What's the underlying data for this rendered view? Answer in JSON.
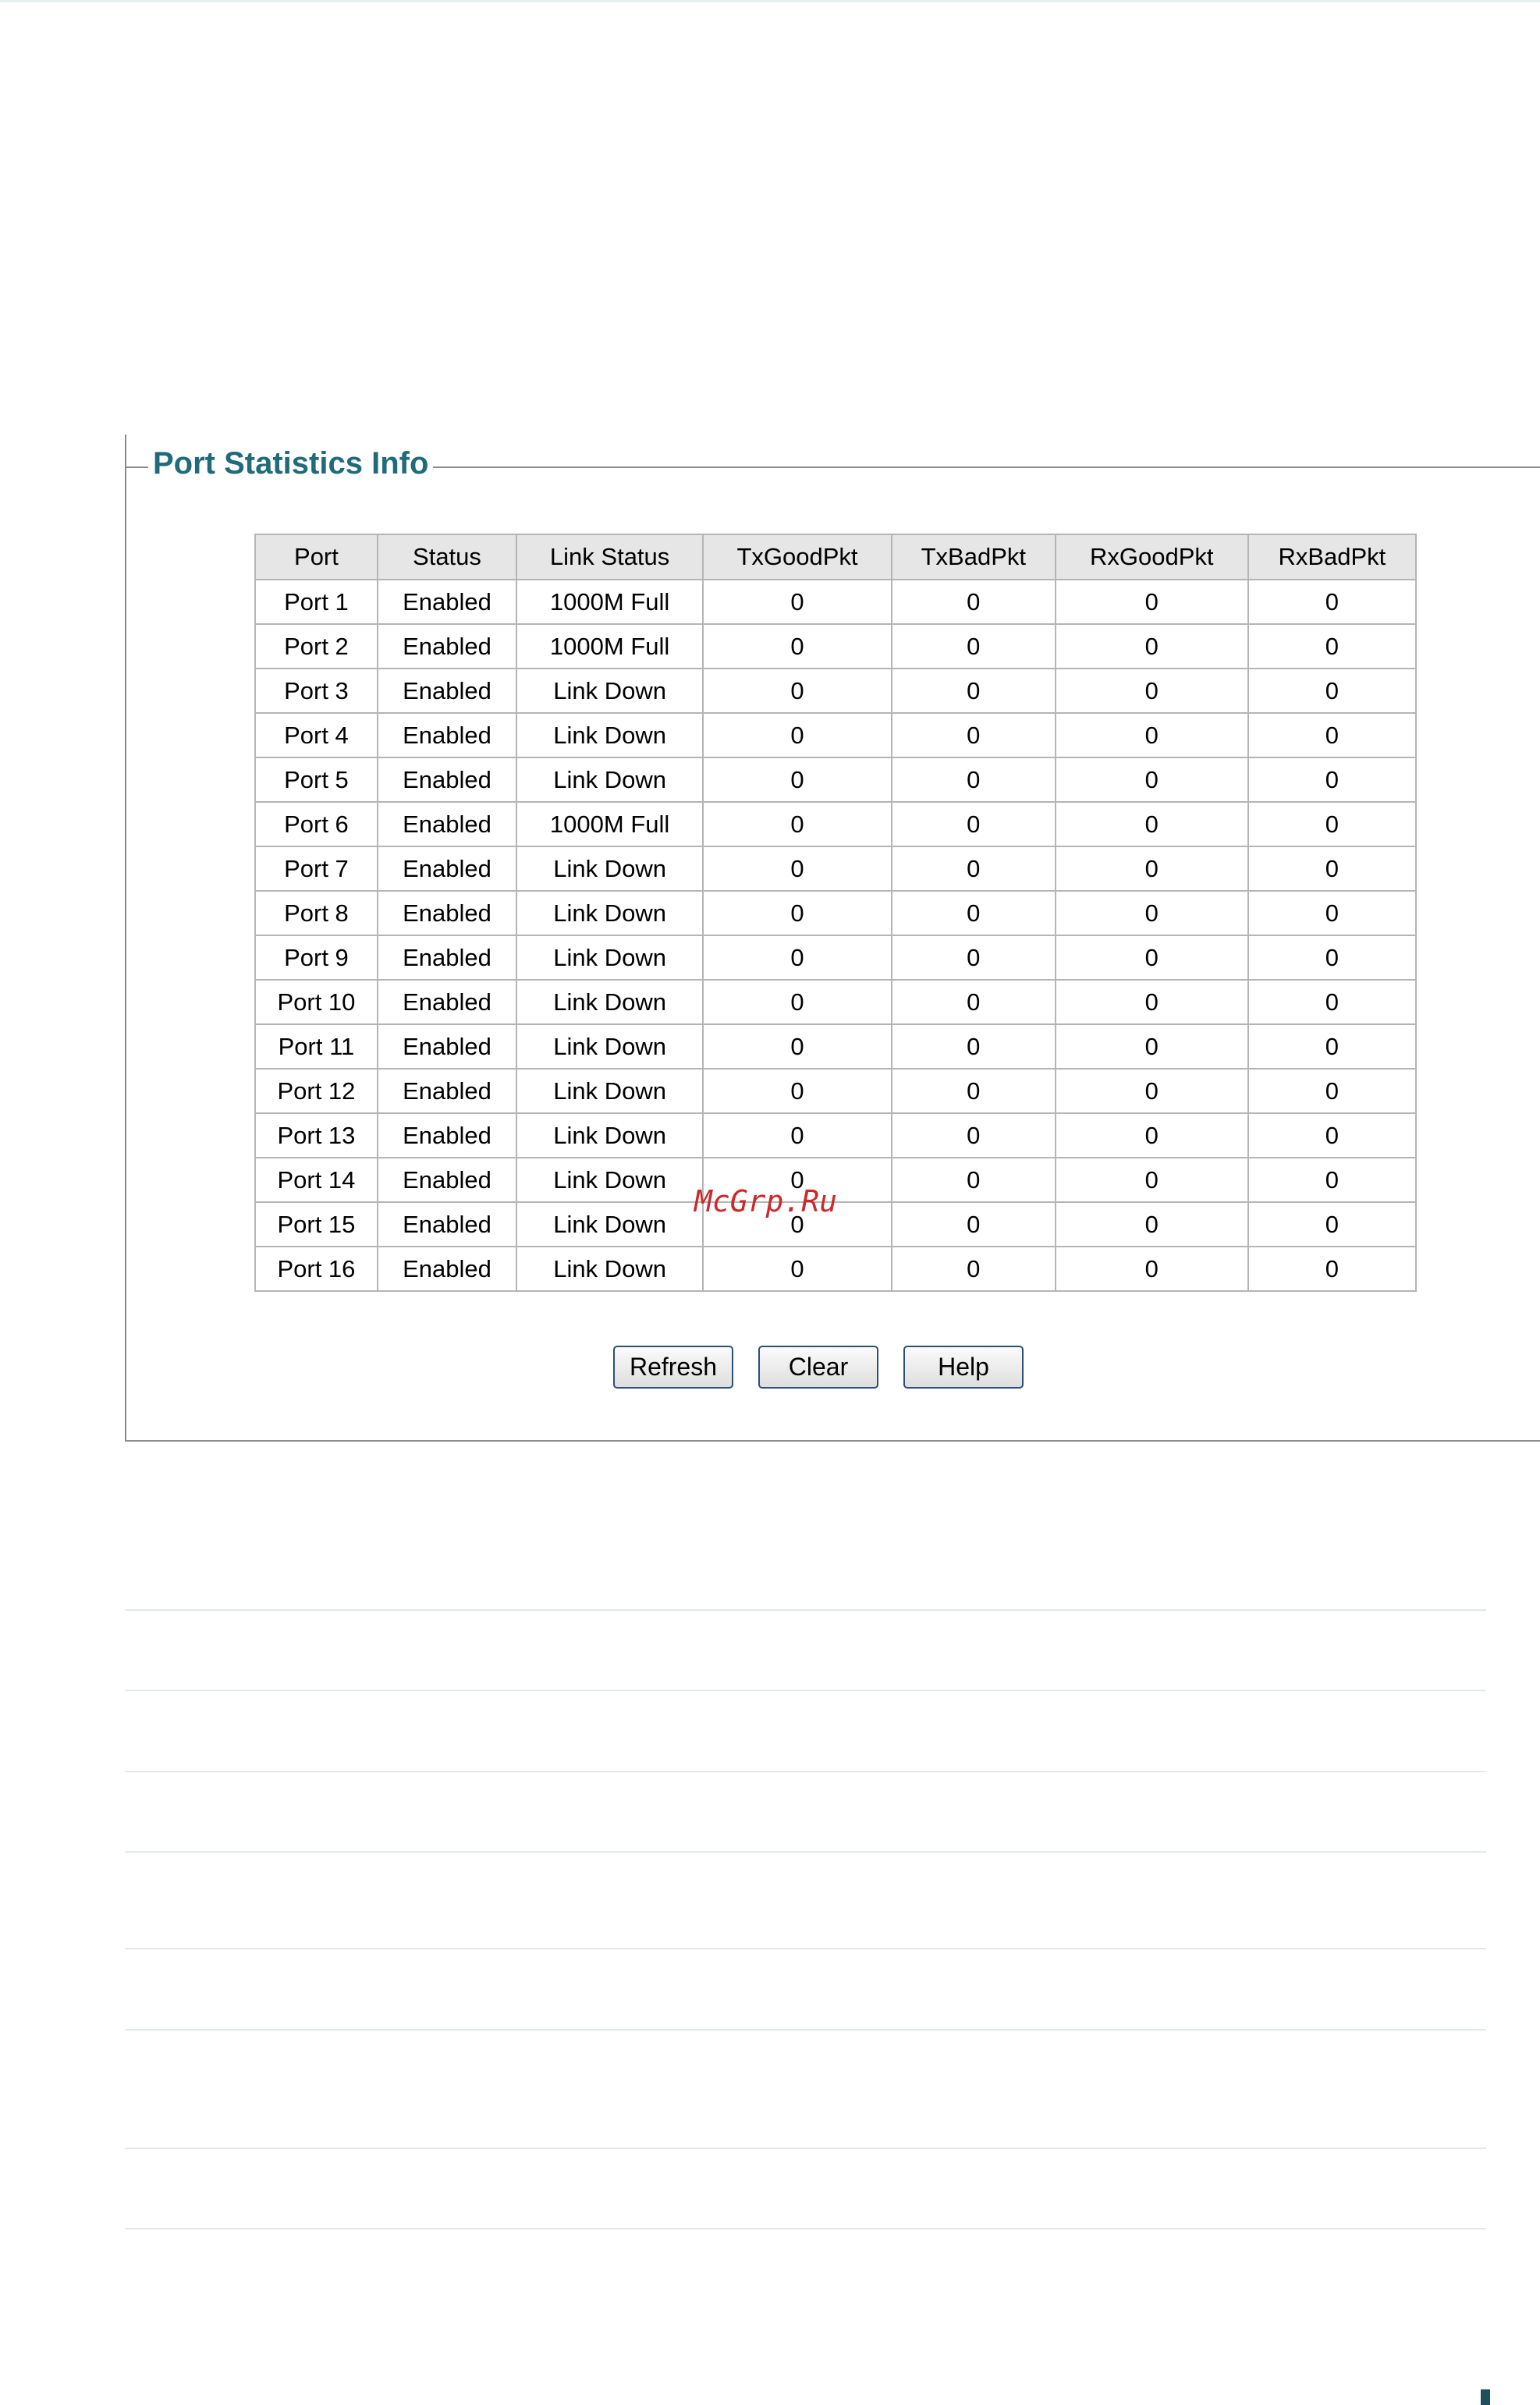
{
  "panel": {
    "title": "Port Statistics Info"
  },
  "table": {
    "headers": [
      "Port",
      "Status",
      "Link Status",
      "TxGoodPkt",
      "TxBadPkt",
      "RxGoodPkt",
      "RxBadPkt"
    ],
    "rows": [
      [
        "Port 1",
        "Enabled",
        "1000M Full",
        "0",
        "0",
        "0",
        "0"
      ],
      [
        "Port 2",
        "Enabled",
        "1000M Full",
        "0",
        "0",
        "0",
        "0"
      ],
      [
        "Port 3",
        "Enabled",
        "Link Down",
        "0",
        "0",
        "0",
        "0"
      ],
      [
        "Port 4",
        "Enabled",
        "Link Down",
        "0",
        "0",
        "0",
        "0"
      ],
      [
        "Port 5",
        "Enabled",
        "Link Down",
        "0",
        "0",
        "0",
        "0"
      ],
      [
        "Port 6",
        "Enabled",
        "1000M Full",
        "0",
        "0",
        "0",
        "0"
      ],
      [
        "Port 7",
        "Enabled",
        "Link Down",
        "0",
        "0",
        "0",
        "0"
      ],
      [
        "Port 8",
        "Enabled",
        "Link Down",
        "0",
        "0",
        "0",
        "0"
      ],
      [
        "Port 9",
        "Enabled",
        "Link Down",
        "0",
        "0",
        "0",
        "0"
      ],
      [
        "Port 10",
        "Enabled",
        "Link Down",
        "0",
        "0",
        "0",
        "0"
      ],
      [
        "Port 11",
        "Enabled",
        "Link Down",
        "0",
        "0",
        "0",
        "0"
      ],
      [
        "Port 12",
        "Enabled",
        "Link Down",
        "0",
        "0",
        "0",
        "0"
      ],
      [
        "Port 13",
        "Enabled",
        "Link Down",
        "0",
        "0",
        "0",
        "0"
      ],
      [
        "Port 14",
        "Enabled",
        "Link Down",
        "0",
        "0",
        "0",
        "0"
      ],
      [
        "Port 15",
        "Enabled",
        "Link Down",
        "0",
        "0",
        "0",
        "0"
      ],
      [
        "Port 16",
        "Enabled",
        "Link Down",
        "0",
        "0",
        "0",
        "0"
      ]
    ]
  },
  "buttons": {
    "refresh": "Refresh",
    "clear": "Clear",
    "help": "Help"
  },
  "watermark": "McGrp.Ru",
  "colors": {
    "title": "#1f6b7a",
    "header_bg": "#e6e6e6",
    "border": "#b5b5b5",
    "button_border": "#2b4f7a",
    "watermark": "#cc2a2a"
  }
}
